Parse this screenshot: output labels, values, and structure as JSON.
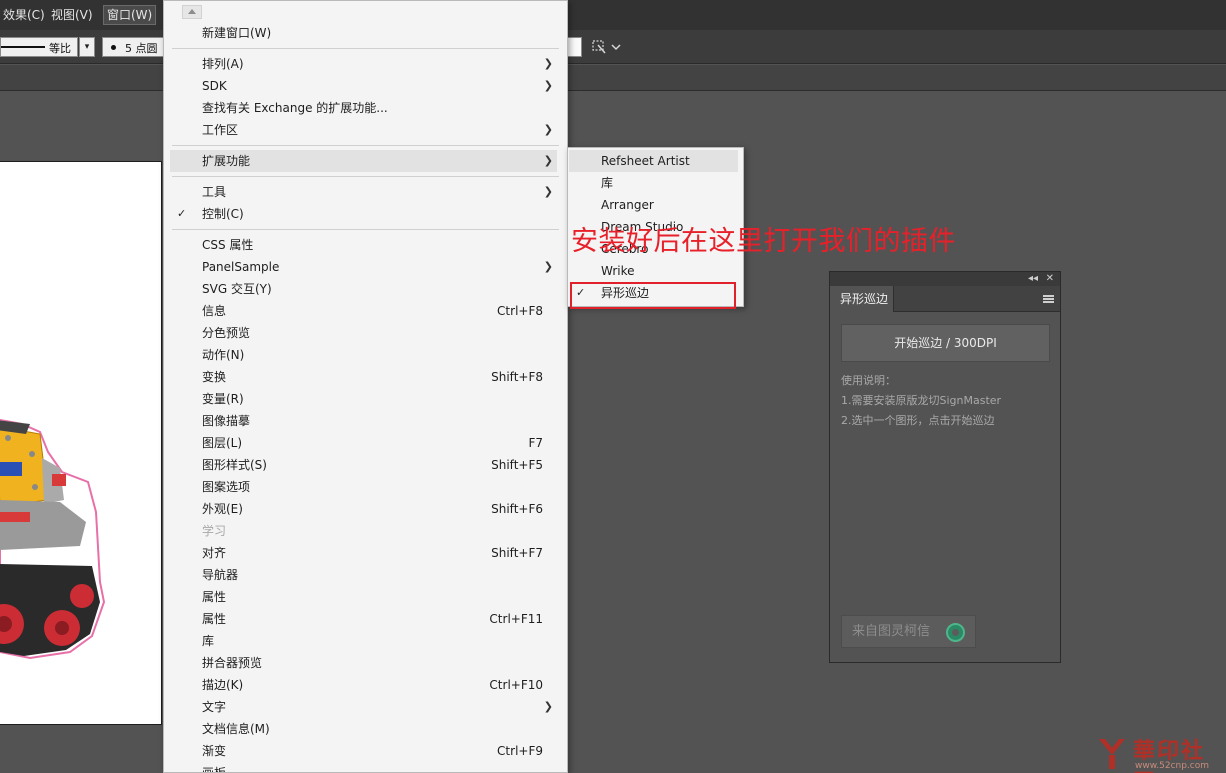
{
  "menubar": {
    "items": [
      {
        "label": "效果(C)"
      },
      {
        "label": "视图(V)"
      },
      {
        "label": "窗口(W)"
      }
    ]
  },
  "controlbar": {
    "stroke_profile_label": "等比",
    "brush_label": "5 点圆"
  },
  "window_menu": {
    "items": [
      {
        "label": "新建窗口(W)"
      },
      {
        "label": "排列(A)"
      },
      {
        "label": "SDK"
      },
      {
        "label": "查找有关 Exchange 的扩展功能..."
      },
      {
        "label": "工作区"
      },
      {
        "label": "扩展功能"
      },
      {
        "label": "工具"
      },
      {
        "label": "控制(C)"
      },
      {
        "label": "CSS 属性"
      },
      {
        "label": "PanelSample"
      },
      {
        "label": "SVG 交互(Y)"
      },
      {
        "label": "信息",
        "shortcut": "Ctrl+F8"
      },
      {
        "label": "分色预览"
      },
      {
        "label": "动作(N)"
      },
      {
        "label": "变换",
        "shortcut": "Shift+F8"
      },
      {
        "label": "变量(R)"
      },
      {
        "label": "图像描摹"
      },
      {
        "label": "图层(L)",
        "shortcut": "F7"
      },
      {
        "label": "图形样式(S)",
        "shortcut": "Shift+F5"
      },
      {
        "label": "图案选项"
      },
      {
        "label": "外观(E)",
        "shortcut": "Shift+F6"
      },
      {
        "label": "学习"
      },
      {
        "label": "对齐",
        "shortcut": "Shift+F7"
      },
      {
        "label": "导航器"
      },
      {
        "label": "属性"
      },
      {
        "label": "属性",
        "shortcut": "Ctrl+F11"
      },
      {
        "label": "库"
      },
      {
        "label": "拼合器预览"
      },
      {
        "label": "描边(K)",
        "shortcut": "Ctrl+F10"
      },
      {
        "label": "文字"
      },
      {
        "label": "文档信息(M)"
      },
      {
        "label": "渐变",
        "shortcut": "Ctrl+F9"
      },
      {
        "label": "画板"
      }
    ]
  },
  "extensions_submenu": {
    "items": [
      {
        "label": "Refsheet Artist"
      },
      {
        "label": "库"
      },
      {
        "label": "Arranger"
      },
      {
        "label": "Dream Studio"
      },
      {
        "label": "Cerebro"
      },
      {
        "label": "Wrike"
      },
      {
        "label": "异形巡边"
      }
    ]
  },
  "annotation": {
    "text": "安装好后在这里打开我们的插件"
  },
  "panel": {
    "tab_label": "异形巡边",
    "start_button_label": "开始巡边 / 300DPI",
    "instructions": [
      "使用说明：",
      "1.需要安装原版龙切SignMaster",
      "2.选中一个图形，点击开始巡边"
    ],
    "credit_label": "来自图灵柯信"
  },
  "watermark": {
    "brand": "華印社區",
    "url": "www.52cnp.com"
  },
  "colors": {
    "menu_background": "#f4f4f4",
    "highlight_box": "#e0202a",
    "annotation_text": "#e8202a",
    "workspace": "#535353"
  }
}
